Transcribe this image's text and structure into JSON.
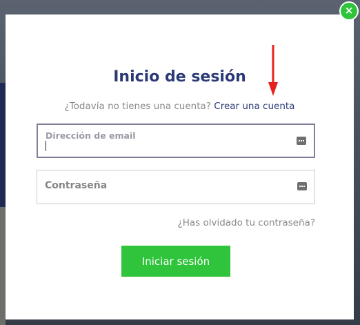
{
  "modal": {
    "title": "Inicio de sesión",
    "subtitle_text": "¿Todavía no tienes una cuenta?",
    "signup_link": "Crear una cuenta",
    "close_label": "×"
  },
  "form": {
    "email": {
      "label": "Dirección de email",
      "value": ""
    },
    "password": {
      "label": "Contraseña",
      "value": ""
    },
    "forgot_link": "¿Has olvidado tu contraseña?",
    "submit_label": "Iniciar sesión"
  },
  "colors": {
    "accent_green": "#2fc43b",
    "title_navy": "#2b3a77",
    "arrow_red": "#e5221b"
  },
  "icons": [
    "close-icon",
    "password-manager-icon",
    "annotation-arrow-icon"
  ]
}
